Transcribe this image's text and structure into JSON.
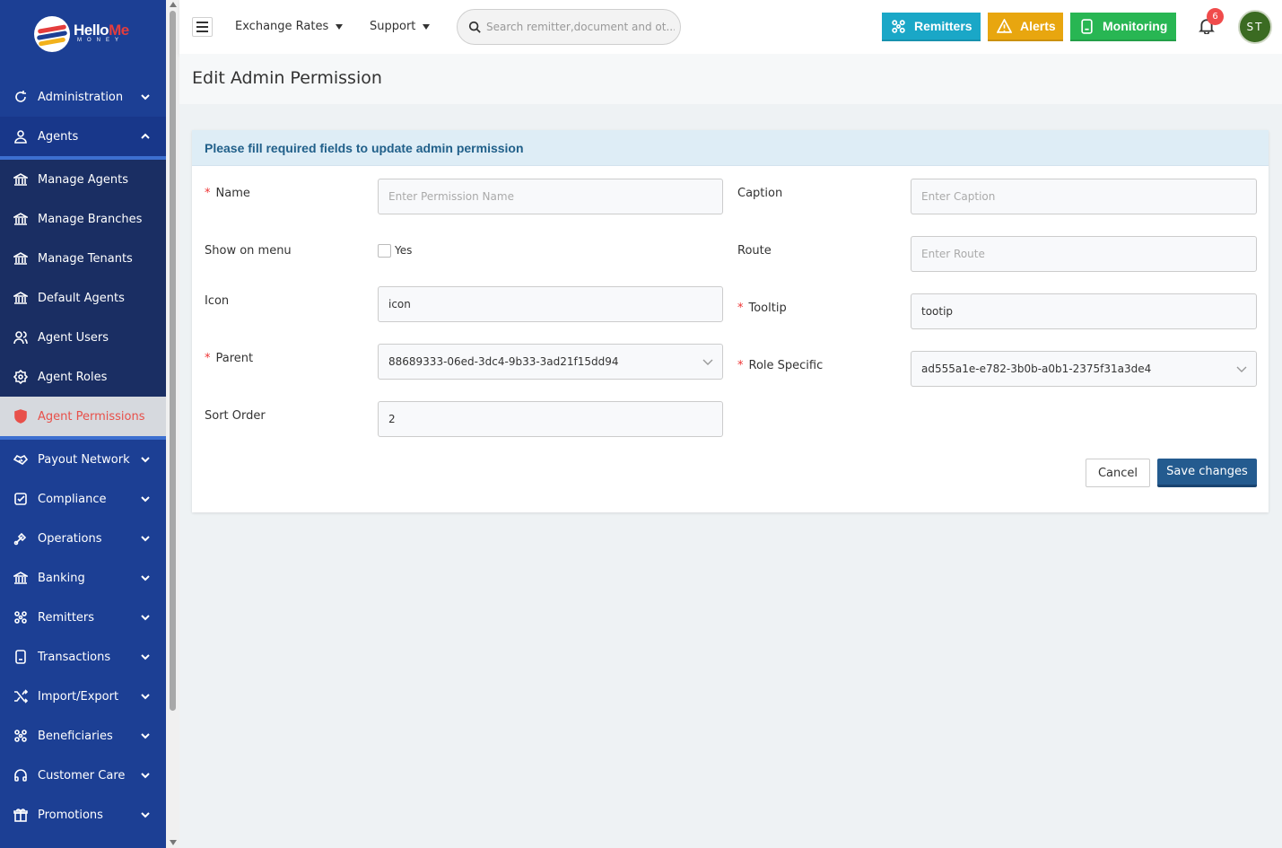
{
  "brand": {
    "name_a": "Hello",
    "name_b": "Me",
    "sub": "MONEY"
  },
  "sidebar": {
    "top_items": [
      {
        "label": "Administration",
        "icon": "refresh-icon"
      },
      {
        "label": "Agents",
        "icon": "user-icon"
      }
    ],
    "agents_submenu": [
      {
        "label": "Manage Agents",
        "icon": "bank-icon"
      },
      {
        "label": "Manage Branches",
        "icon": "bank-icon"
      },
      {
        "label": "Manage Tenants",
        "icon": "bank-icon"
      },
      {
        "label": "Default Agents",
        "icon": "bank-icon"
      },
      {
        "label": "Agent Users",
        "icon": "users-icon"
      },
      {
        "label": "Agent Roles",
        "icon": "role-icon"
      },
      {
        "label": "Agent Permissions",
        "icon": "shield-icon",
        "active": true
      }
    ],
    "bottom_items": [
      {
        "label": "Payout Network",
        "icon": "handshake-icon"
      },
      {
        "label": "Compliance",
        "icon": "checkbox-icon"
      },
      {
        "label": "Operations",
        "icon": "operations-icon"
      },
      {
        "label": "Banking",
        "icon": "bank-icon"
      },
      {
        "label": "Remitters",
        "icon": "network-icon"
      },
      {
        "label": "Transactions",
        "icon": "receipt-icon"
      },
      {
        "label": "Import/Export",
        "icon": "shuffle-icon"
      },
      {
        "label": "Beneficiaries",
        "icon": "network-icon"
      },
      {
        "label": "Customer Care",
        "icon": "headset-icon"
      },
      {
        "label": "Promotions",
        "icon": "gift-icon"
      }
    ]
  },
  "topbar": {
    "exchange_rates": "Exchange Rates",
    "support": "Support",
    "search_placeholder": "Search remitter,document and ot...",
    "remitters": "Remitters",
    "alerts": "Alerts",
    "monitoring": "Monitoring",
    "notifications": "6",
    "avatar": "ST"
  },
  "page": {
    "title": "Edit Admin Permission"
  },
  "form": {
    "heading": "Please fill required fields to update admin permission",
    "name_label": "Name",
    "name_placeholder": "Enter Permission Name",
    "name_value": "",
    "caption_label": "Caption",
    "caption_placeholder": "Enter Caption",
    "caption_value": "",
    "show_on_menu_label": "Show on menu",
    "show_on_menu_option": "Yes",
    "route_label": "Route",
    "route_placeholder": "Enter Route",
    "route_value": "",
    "icon_label": "Icon",
    "icon_value": "icon",
    "tooltip_label": "Tooltip",
    "tooltip_value": "tootip",
    "parent_label": "Parent",
    "parent_value": "88689333-06ed-3dc4-9b33-3ad21f15dd94",
    "role_specific_label": "Role Specific",
    "role_specific_value": "ad555a1e-e782-3b0b-a0b1-2375f31a3de4",
    "sort_order_label": "Sort Order",
    "sort_order_value": "2",
    "cancel": "Cancel",
    "save": "Save changes"
  }
}
